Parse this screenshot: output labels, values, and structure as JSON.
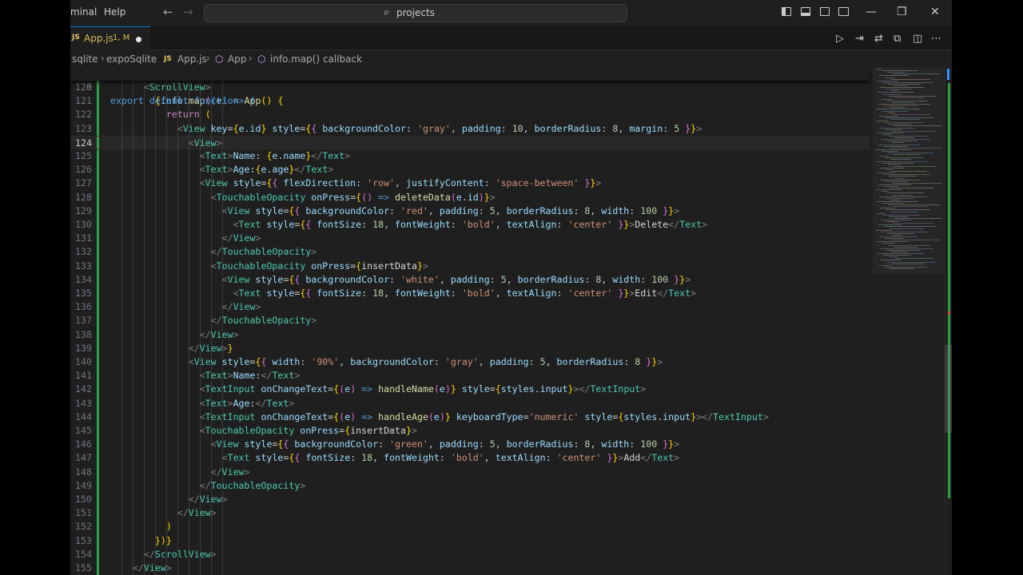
{
  "window": {
    "menu": [
      "minal",
      "Help"
    ],
    "search_text": "projects"
  },
  "tab": {
    "badge": "JS",
    "name": "App.js",
    "status": "1, M"
  },
  "breadcrumb": [
    {
      "text": "sqlite"
    },
    {
      "text": "expoSqlite"
    },
    {
      "text": "App.js",
      "badge": "JS"
    },
    {
      "text": "App",
      "icon": "cube-icon"
    },
    {
      "text": "info.map() callback",
      "icon": "cube-icon"
    }
  ],
  "editor": {
    "sticky": {
      "num": "8",
      "text": "export default function App() {"
    },
    "current_line": "124",
    "lines": [
      {
        "num": "120",
        "text": "      <ScrollView>"
      },
      {
        "num": "121",
        "text": "        {info.map((e) => ("
      },
      {
        "num": "122",
        "text": "          return ("
      },
      {
        "num": "123",
        "text": "            <View key={e.id} style={{ backgroundColor: 'gray', padding: 10, borderRadius: 8, margin: 5 }}>"
      },
      {
        "num": "124",
        "text": "              <View>"
      },
      {
        "num": "125",
        "text": "                <Text>Name: {e.name}</Text>"
      },
      {
        "num": "126",
        "text": "                <Text>Age:{e.age}</Text>"
      },
      {
        "num": "127",
        "text": "                <View style={{ flexDirection: 'row', justifyContent: 'space-between' }}>"
      },
      {
        "num": "128",
        "text": "                  <TouchableOpacity onPress={() => deleteData(e.id)}>"
      },
      {
        "num": "129",
        "text": "                    <View style={{ backgroundColor: 'red', padding: 5, borderRadius: 8, width: 100 }}>"
      },
      {
        "num": "130",
        "text": "                      <Text style={{ fontSize: 18, fontWeight: 'bold', textAlign: 'center' }}>Delete</Text>"
      },
      {
        "num": "131",
        "text": "                    </View>"
      },
      {
        "num": "132",
        "text": "                  </TouchableOpacity>"
      },
      {
        "num": "133",
        "text": "                  <TouchableOpacity onPress={insertData}>"
      },
      {
        "num": "134",
        "text": "                    <View style={{ backgroundColor: 'white', padding: 5, borderRadius: 8, width: 100 }}>"
      },
      {
        "num": "135",
        "text": "                      <Text style={{ fontSize: 18, fontWeight: 'bold', textAlign: 'center' }}>Edit</Text>"
      },
      {
        "num": "136",
        "text": "                    </View>"
      },
      {
        "num": "137",
        "text": "                  </TouchableOpacity>"
      },
      {
        "num": "138",
        "text": "                </View>"
      },
      {
        "num": "139",
        "text": "              </View>}"
      },
      {
        "num": "140",
        "text": "              <View style={{ width: '90%', backgroundColor: 'gray', padding: 5, borderRadius: 8 }}>"
      },
      {
        "num": "141",
        "text": "                <Text>Name:</Text>"
      },
      {
        "num": "142",
        "text": "                <TextInput onChangeText={(e) => handleName(e)} style={styles.input}></TextInput>"
      },
      {
        "num": "143",
        "text": "                <Text>Age:</Text>"
      },
      {
        "num": "144",
        "text": "                <TextInput onChangeText={(e) => handleAge(e)} keyboardType='numeric' style={styles.input}></TextInput>"
      },
      {
        "num": "145",
        "text": "                <TouchableOpacity onPress={insertData}>"
      },
      {
        "num": "146",
        "text": "                  <View style={{ backgroundColor: 'green', padding: 5, borderRadius: 8, width: 100 }}>"
      },
      {
        "num": "147",
        "text": "                    <Text style={{ fontSize: 18, fontWeight: 'bold', textAlign: 'center' }}>Add</Text>"
      },
      {
        "num": "148",
        "text": "                  </View>"
      },
      {
        "num": "149",
        "text": "                </TouchableOpacity>"
      },
      {
        "num": "150",
        "text": "              </View>"
      },
      {
        "num": "151",
        "text": "            </View>"
      },
      {
        "num": "152",
        "text": "          )"
      },
      {
        "num": "153",
        "text": "        })}"
      },
      {
        "num": "154",
        "text": "      </ScrollView>"
      },
      {
        "num": "155",
        "text": "    </View>"
      }
    ]
  },
  "colors": {
    "accent": "#0078d4",
    "modified_gutter": "#2ea043",
    "editor_bg": "#1f1f1f"
  }
}
